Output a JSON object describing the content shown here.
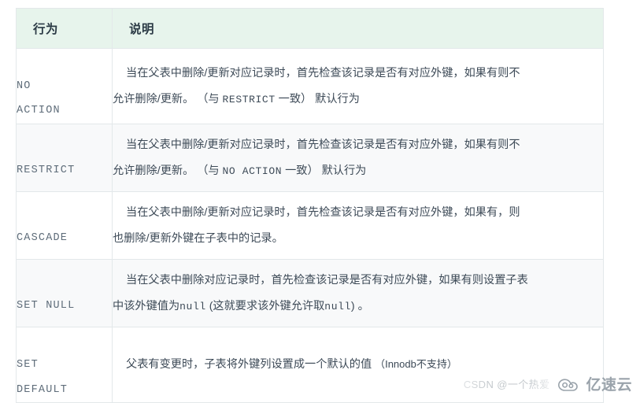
{
  "table": {
    "headers": {
      "action": "行为",
      "description": "说明"
    },
    "rows": [
      {
        "action_lines": [
          "NO",
          "ACTION"
        ],
        "action_plain": "NO ACTION",
        "desc_line1": "当在父表中删除/更新对应记录时，首先检查该记录是否有对应外键，如果有则不",
        "desc_line2_pre": "允许删除/更新。 （与 ",
        "desc_line2_mono": "RESTRICT",
        "desc_line2_post": " 一致） 默认行为"
      },
      {
        "action_lines": [
          "RESTRICT"
        ],
        "action_plain": "RESTRICT",
        "desc_line1": "当在父表中删除/更新对应记录时，首先检查该记录是否有对应外键，如果有则不",
        "desc_line2_pre": "允许删除/更新。 （与 ",
        "desc_line2_mono": "NO ACTION",
        "desc_line2_post": " 一致） 默认行为"
      },
      {
        "action_lines": [
          "CASCADE"
        ],
        "action_plain": "CASCADE",
        "desc_line1": "当在父表中删除/更新对应记录时，首先检查该记录是否有对应外键，如果有，则",
        "desc_line2_pre": "也删除/更新外键在子表中的记录。",
        "desc_line2_mono": "",
        "desc_line2_post": ""
      },
      {
        "action_lines": [
          "SET NULL"
        ],
        "action_plain": "SET NULL",
        "desc_line1": "当在父表中删除对应记录时，首先检查该记录是否有对应外键，如果有则设置子表",
        "desc_line2_pre": "中该外键值为",
        "desc_line2_mono": "null",
        "desc_line2_post": " (这就要求该外键允许取",
        "desc_line2_mono2": "null",
        "desc_line2_tail": ") 。"
      },
      {
        "action_lines": [
          "SET",
          "DEFAULT"
        ],
        "action_plain": "SET DEFAULT",
        "desc_line1": "父表有变更时，子表将外键列设置成一个默认的值 ",
        "desc_line1_note": "（Innodb不支持）",
        "desc_line2_pre": "",
        "desc_line2_mono": "",
        "desc_line2_post": ""
      }
    ]
  },
  "watermark": {
    "csdn_text": "CSDN @一个热爱",
    "brand_text": "亿速云",
    "logo_icon": "cloud-icon"
  },
  "colors": {
    "header_bg": "#e7f4ec",
    "row_odd_bg": "#ffffff",
    "row_even_bg": "#f8f9fa",
    "border": "#e3e8ea",
    "header_text": "#2b3a45",
    "body_text": "#3d4a57",
    "mono_text": "#5f6d7a",
    "watermark": "#c4c9cd"
  }
}
